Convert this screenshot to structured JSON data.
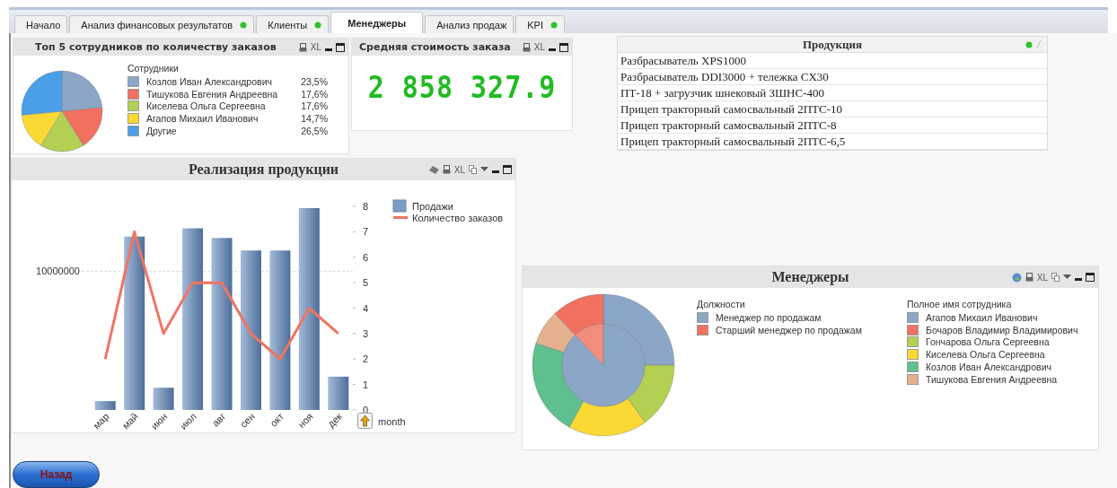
{
  "tabs": [
    {
      "label": "Начало",
      "selected": false,
      "indicator": false
    },
    {
      "label": "Анализ финансовых результатов",
      "selected": false,
      "indicator": true
    },
    {
      "label": "Клиенты",
      "selected": false,
      "indicator": true
    },
    {
      "label": "Менеджеры",
      "selected": true,
      "indicator": false
    },
    {
      "label": "Анализ продаж",
      "selected": false,
      "indicator": false
    },
    {
      "label": "KPI",
      "selected": false,
      "indicator": true
    }
  ],
  "top_employees": {
    "title": "Топ 5 сотрудников по количеству заказов",
    "tools": [
      {
        "kind": "print"
      },
      {
        "kind": "xl",
        "label": "XL"
      },
      {
        "kind": "minimize"
      },
      {
        "kind": "maximize"
      }
    ],
    "chart_data": {
      "type": "pie",
      "title": "Сотрудники",
      "categories": [
        "Козлов Иван Александрович",
        "Тишукова Евгения Андреевна",
        "Киселева Ольга Сергеевна",
        "Агапов Михаил Иванович",
        "Другие"
      ],
      "values": [
        23.5,
        17.6,
        17.6,
        14.7,
        26.5
      ],
      "value_labels": [
        "23,5%",
        "17,6%",
        "17,6%",
        "14,7%",
        "26,5%"
      ],
      "colors": [
        "#8ba6c7",
        "#f2705f",
        "#b4d053",
        "#fbd934",
        "#4b9fe8"
      ]
    }
  },
  "average_order": {
    "title": "Средняя стоимость заказа",
    "tools": [
      {
        "kind": "print"
      },
      {
        "kind": "xl",
        "label": "XL"
      },
      {
        "kind": "minimize"
      },
      {
        "kind": "maximize"
      }
    ],
    "value": "2 858 327.9"
  },
  "products": {
    "title": "Продукция",
    "tools": [
      {
        "kind": "dot"
      },
      {
        "kind": "edit"
      }
    ],
    "rows": [
      "Разбрасыватель XPS1000",
      "Разбрасыватель DDI3000 + тележка CX30",
      "ПТ-18 + загрузчик шнековый ЗШНС-400",
      "Прицеп тракторный самосвальный 2ПТС-10",
      "Прицеп тракторный самосвальный 2ПТС-8",
      "Прицеп тракторный самосвальный 2ПТС-6,5"
    ]
  },
  "sales_chart": {
    "title": "Реализация продукции",
    "tools": [
      {
        "kind": "clear"
      },
      {
        "kind": "print"
      },
      {
        "kind": "xl",
        "label": "XL"
      },
      {
        "kind": "copy"
      },
      {
        "kind": "menu"
      },
      {
        "kind": "minimize"
      },
      {
        "kind": "maximize"
      }
    ],
    "dimension_label": "month",
    "sales_legend": {
      "name": "Продажи",
      "color": "#7d9cc4"
    },
    "sales_scale_label": "10000000",
    "chart_data": {
      "type": "line",
      "categories": [
        "мар",
        "май",
        "июн",
        "июл",
        "авг",
        "сен",
        "окт",
        "ноя",
        "дек"
      ],
      "series": [
        {
          "name": "Количество заказов",
          "color": "#f07462",
          "values": [
            2,
            7,
            3,
            5,
            5,
            3,
            2,
            4,
            3
          ]
        }
      ],
      "ylim": [
        0,
        8
      ],
      "yticks": [
        0,
        1,
        2,
        3,
        4,
        5,
        6,
        7,
        8
      ],
      "legend": true
    }
  },
  "managers": {
    "title": "Менеджеры",
    "tools": [
      {
        "kind": "export"
      },
      {
        "kind": "print"
      },
      {
        "kind": "xl",
        "label": "XL"
      },
      {
        "kind": "copy"
      },
      {
        "kind": "menu"
      },
      {
        "kind": "minimize"
      },
      {
        "kind": "maximize"
      }
    ],
    "positions": {
      "title": "Должности",
      "items": [
        {
          "label": "Менеджер по продажам",
          "color": "#8ba6c7"
        },
        {
          "label": "Старший менеджер по продажам",
          "color": "#f2705f"
        }
      ]
    },
    "employees": {
      "title": "Полное имя сотрудника",
      "items": [
        {
          "label": "Агапов Михаил Иванович",
          "color": "#8ba6c7"
        },
        {
          "label": "Бочаров Владимир Владимирович",
          "color": "#f2705f"
        },
        {
          "label": "Гончарова Ольга Сергеевна",
          "color": "#b4d053"
        },
        {
          "label": "Киселева Ольга Сергеевна",
          "color": "#fbd934"
        },
        {
          "label": "Козлов Иван Александрович",
          "color": "#5fbf8e"
        },
        {
          "label": "Тишукова Евгения Андреевна",
          "color": "#e4b08e"
        }
      ]
    }
  },
  "back_button": "Назад"
}
